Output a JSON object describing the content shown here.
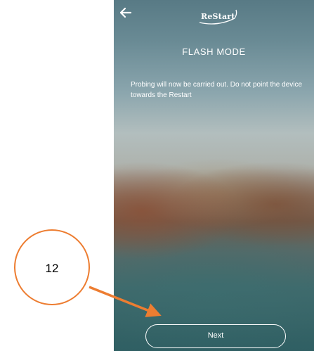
{
  "app": {
    "logo_text": "ReStart"
  },
  "screen": {
    "title": "FLASH MODE",
    "message": "Probing will now be carried out. Do not point the device towards the Restart",
    "next_label": "Next"
  },
  "annotation": {
    "step_number": "12",
    "color": "#ed7d31"
  },
  "icons": {
    "back": "back-arrow-icon",
    "logo": "restart-logo"
  }
}
